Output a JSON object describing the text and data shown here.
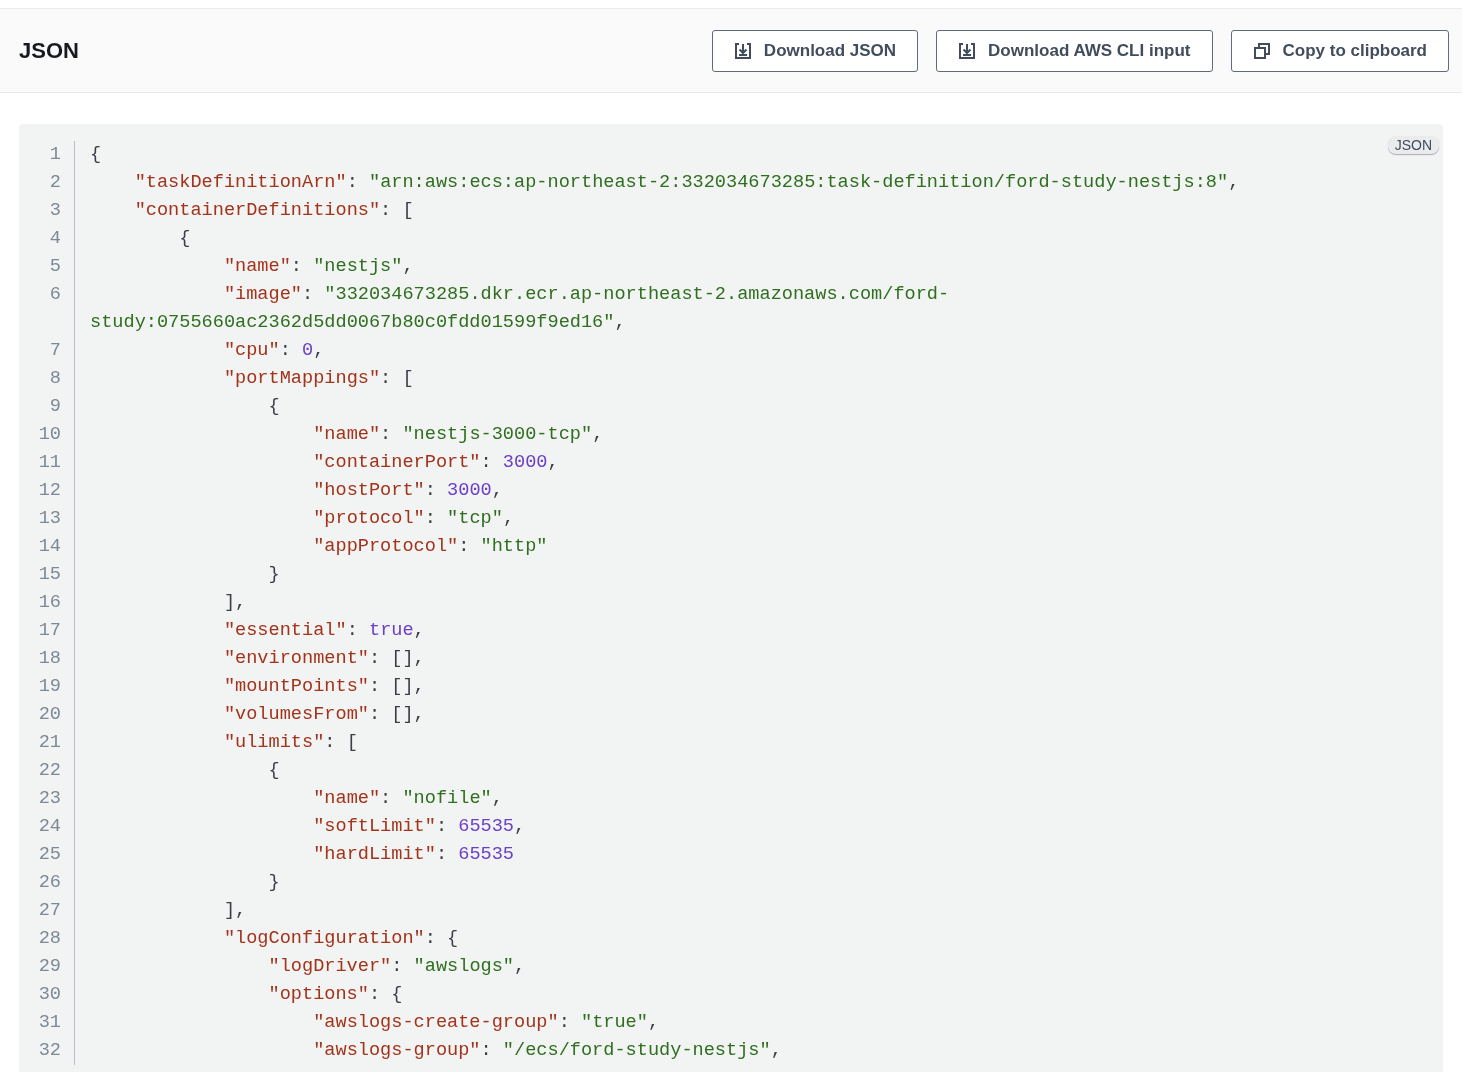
{
  "header": {
    "title": "JSON",
    "buttons": [
      {
        "kind": "download",
        "label": "Download JSON"
      },
      {
        "kind": "download",
        "label": "Download AWS CLI input"
      },
      {
        "kind": "copy",
        "label": "Copy to clipboard"
      }
    ]
  },
  "code": {
    "badge": "JSON",
    "lines": [
      {
        "number": "1",
        "tokens": [
          {
            "kind": "p",
            "text": "{"
          }
        ],
        "children": [
          {
            "number": "2",
            "tokens": [
              {
                "kind": "k",
                "text": "\"taskDefinitionArn\""
              },
              {
                "kind": "p",
                "text": ": "
              },
              {
                "kind": "s",
                "text": "\"arn:aws:ecs:ap-northeast-2:332034673285:task-definition/ford-study-nestjs:8\""
              },
              {
                "kind": "p",
                "text": ","
              }
            ]
          },
          {
            "number": "3",
            "tokens": [
              {
                "kind": "k",
                "text": "\"containerDefinitions\""
              },
              {
                "kind": "p",
                "text": ": ["
              }
            ],
            "children": [
              {
                "number": "4",
                "tokens": [
                  {
                    "kind": "p",
                    "text": "{"
                  }
                ],
                "children": [
                  {
                    "number": "5",
                    "tokens": [
                      {
                        "kind": "k",
                        "text": "\"name\""
                      },
                      {
                        "kind": "p",
                        "text": ": "
                      },
                      {
                        "kind": "s",
                        "text": "\"nestjs\""
                      },
                      {
                        "kind": "p",
                        "text": ","
                      }
                    ]
                  },
                  {
                    "number": "6",
                    "tokens": [
                      {
                        "kind": "k",
                        "text": "\"image\""
                      },
                      {
                        "kind": "p",
                        "text": ": "
                      },
                      {
                        "kind": "s",
                        "text": "\"332034673285.dkr.ecr.ap-northeast-2.amazonaws.com/ford-study:0755660ac2362d5dd0067b80c0fdd01599f9ed16\""
                      },
                      {
                        "kind": "p",
                        "text": ","
                      }
                    ]
                  },
                  {
                    "number": "7",
                    "tokens": [
                      {
                        "kind": "k",
                        "text": "\"cpu\""
                      },
                      {
                        "kind": "p",
                        "text": ": "
                      },
                      {
                        "kind": "n",
                        "text": "0"
                      },
                      {
                        "kind": "p",
                        "text": ","
                      }
                    ]
                  },
                  {
                    "number": "8",
                    "tokens": [
                      {
                        "kind": "k",
                        "text": "\"portMappings\""
                      },
                      {
                        "kind": "p",
                        "text": ": ["
                      }
                    ],
                    "children": [
                      {
                        "number": "9",
                        "tokens": [
                          {
                            "kind": "p",
                            "text": "{"
                          }
                        ],
                        "children": [
                          {
                            "number": "10",
                            "tokens": [
                              {
                                "kind": "k",
                                "text": "\"name\""
                              },
                              {
                                "kind": "p",
                                "text": ": "
                              },
                              {
                                "kind": "s",
                                "text": "\"nestjs-3000-tcp\""
                              },
                              {
                                "kind": "p",
                                "text": ","
                              }
                            ]
                          },
                          {
                            "number": "11",
                            "tokens": [
                              {
                                "kind": "k",
                                "text": "\"containerPort\""
                              },
                              {
                                "kind": "p",
                                "text": ": "
                              },
                              {
                                "kind": "n",
                                "text": "3000"
                              },
                              {
                                "kind": "p",
                                "text": ","
                              }
                            ]
                          },
                          {
                            "number": "12",
                            "tokens": [
                              {
                                "kind": "k",
                                "text": "\"hostPort\""
                              },
                              {
                                "kind": "p",
                                "text": ": "
                              },
                              {
                                "kind": "n",
                                "text": "3000"
                              },
                              {
                                "kind": "p",
                                "text": ","
                              }
                            ]
                          },
                          {
                            "number": "13",
                            "tokens": [
                              {
                                "kind": "k",
                                "text": "\"protocol\""
                              },
                              {
                                "kind": "p",
                                "text": ": "
                              },
                              {
                                "kind": "s",
                                "text": "\"tcp\""
                              },
                              {
                                "kind": "p",
                                "text": ","
                              }
                            ]
                          },
                          {
                            "number": "14",
                            "tokens": [
                              {
                                "kind": "k",
                                "text": "\"appProtocol\""
                              },
                              {
                                "kind": "p",
                                "text": ": "
                              },
                              {
                                "kind": "s",
                                "text": "\"http\""
                              }
                            ]
                          }
                        ]
                      },
                      {
                        "number": "15",
                        "tokens": [
                          {
                            "kind": "p",
                            "text": "}"
                          }
                        ]
                      }
                    ]
                  },
                  {
                    "number": "16",
                    "tokens": [
                      {
                        "kind": "p",
                        "text": "],"
                      }
                    ]
                  },
                  {
                    "number": "17",
                    "tokens": [
                      {
                        "kind": "k",
                        "text": "\"essential\""
                      },
                      {
                        "kind": "p",
                        "text": ": "
                      },
                      {
                        "kind": "n",
                        "text": "true"
                      },
                      {
                        "kind": "p",
                        "text": ","
                      }
                    ]
                  },
                  {
                    "number": "18",
                    "tokens": [
                      {
                        "kind": "k",
                        "text": "\"environment\""
                      },
                      {
                        "kind": "p",
                        "text": ": [],"
                      }
                    ]
                  },
                  {
                    "number": "19",
                    "tokens": [
                      {
                        "kind": "k",
                        "text": "\"mountPoints\""
                      },
                      {
                        "kind": "p",
                        "text": ": [],"
                      }
                    ]
                  },
                  {
                    "number": "20",
                    "tokens": [
                      {
                        "kind": "k",
                        "text": "\"volumesFrom\""
                      },
                      {
                        "kind": "p",
                        "text": ": [],"
                      }
                    ]
                  },
                  {
                    "number": "21",
                    "tokens": [
                      {
                        "kind": "k",
                        "text": "\"ulimits\""
                      },
                      {
                        "kind": "p",
                        "text": ": ["
                      }
                    ],
                    "children": [
                      {
                        "number": "22",
                        "tokens": [
                          {
                            "kind": "p",
                            "text": "{"
                          }
                        ],
                        "children": [
                          {
                            "number": "23",
                            "tokens": [
                              {
                                "kind": "k",
                                "text": "\"name\""
                              },
                              {
                                "kind": "p",
                                "text": ": "
                              },
                              {
                                "kind": "s",
                                "text": "\"nofile\""
                              },
                              {
                                "kind": "p",
                                "text": ","
                              }
                            ]
                          },
                          {
                            "number": "24",
                            "tokens": [
                              {
                                "kind": "k",
                                "text": "\"softLimit\""
                              },
                              {
                                "kind": "p",
                                "text": ": "
                              },
                              {
                                "kind": "n",
                                "text": "65535"
                              },
                              {
                                "kind": "p",
                                "text": ","
                              }
                            ]
                          },
                          {
                            "number": "25",
                            "tokens": [
                              {
                                "kind": "k",
                                "text": "\"hardLimit\""
                              },
                              {
                                "kind": "p",
                                "text": ": "
                              },
                              {
                                "kind": "n",
                                "text": "65535"
                              }
                            ]
                          }
                        ]
                      },
                      {
                        "number": "26",
                        "tokens": [
                          {
                            "kind": "p",
                            "text": "}"
                          }
                        ]
                      }
                    ]
                  },
                  {
                    "number": "27",
                    "tokens": [
                      {
                        "kind": "p",
                        "text": "],"
                      }
                    ]
                  },
                  {
                    "number": "28",
                    "tokens": [
                      {
                        "kind": "k",
                        "text": "\"logConfiguration\""
                      },
                      {
                        "kind": "p",
                        "text": ": {"
                      }
                    ],
                    "children": [
                      {
                        "number": "29",
                        "tokens": [
                          {
                            "kind": "k",
                            "text": "\"logDriver\""
                          },
                          {
                            "kind": "p",
                            "text": ": "
                          },
                          {
                            "kind": "s",
                            "text": "\"awslogs\""
                          },
                          {
                            "kind": "p",
                            "text": ","
                          }
                        ]
                      },
                      {
                        "number": "30",
                        "tokens": [
                          {
                            "kind": "k",
                            "text": "\"options\""
                          },
                          {
                            "kind": "p",
                            "text": ": {"
                          }
                        ],
                        "children": [
                          {
                            "number": "31",
                            "tokens": [
                              {
                                "kind": "k",
                                "text": "\"awslogs-create-group\""
                              },
                              {
                                "kind": "p",
                                "text": ": "
                              },
                              {
                                "kind": "s",
                                "text": "\"true\""
                              },
                              {
                                "kind": "p",
                                "text": ","
                              }
                            ]
                          },
                          {
                            "number": "32",
                            "tokens": [
                              {
                                "kind": "k",
                                "text": "\"awslogs-group\""
                              },
                              {
                                "kind": "p",
                                "text": ": "
                              },
                              {
                                "kind": "s",
                                "text": "\"/ecs/ford-study-nestjs\""
                              },
                              {
                                "kind": "p",
                                "text": ","
                              }
                            ]
                          }
                        ]
                      }
                    ]
                  }
                ]
              }
            ]
          }
        ]
      }
    ]
  }
}
